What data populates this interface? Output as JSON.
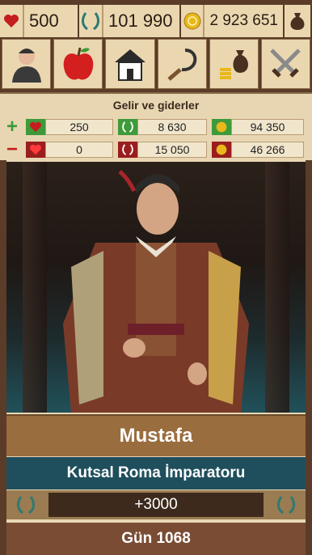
{
  "topbar": {
    "health": "500",
    "reputation": "101 990",
    "gold": "2 923 651",
    "icons": [
      "heart-icon",
      "laurel-icon",
      "coin-icon",
      "money-bag-icon"
    ]
  },
  "menu": {
    "items": [
      "character",
      "food",
      "house",
      "sickle",
      "money",
      "battle"
    ]
  },
  "income": {
    "title": "Gelir ve giderler",
    "plus": {
      "health": "250",
      "reputation": "8 630",
      "gold": "94 350"
    },
    "minus": {
      "health": "0",
      "reputation": "15 050",
      "gold": "46 266"
    }
  },
  "character": {
    "name": "Mustafa",
    "title": "Kutsal Roma İmparatoru",
    "reputation_change": "+3000",
    "day": "Gün 1068"
  },
  "colors": {
    "brown": "#5a3c28",
    "teal": "#1f4e5c",
    "green": "#3e9a3a",
    "red": "#9a1e1e"
  }
}
